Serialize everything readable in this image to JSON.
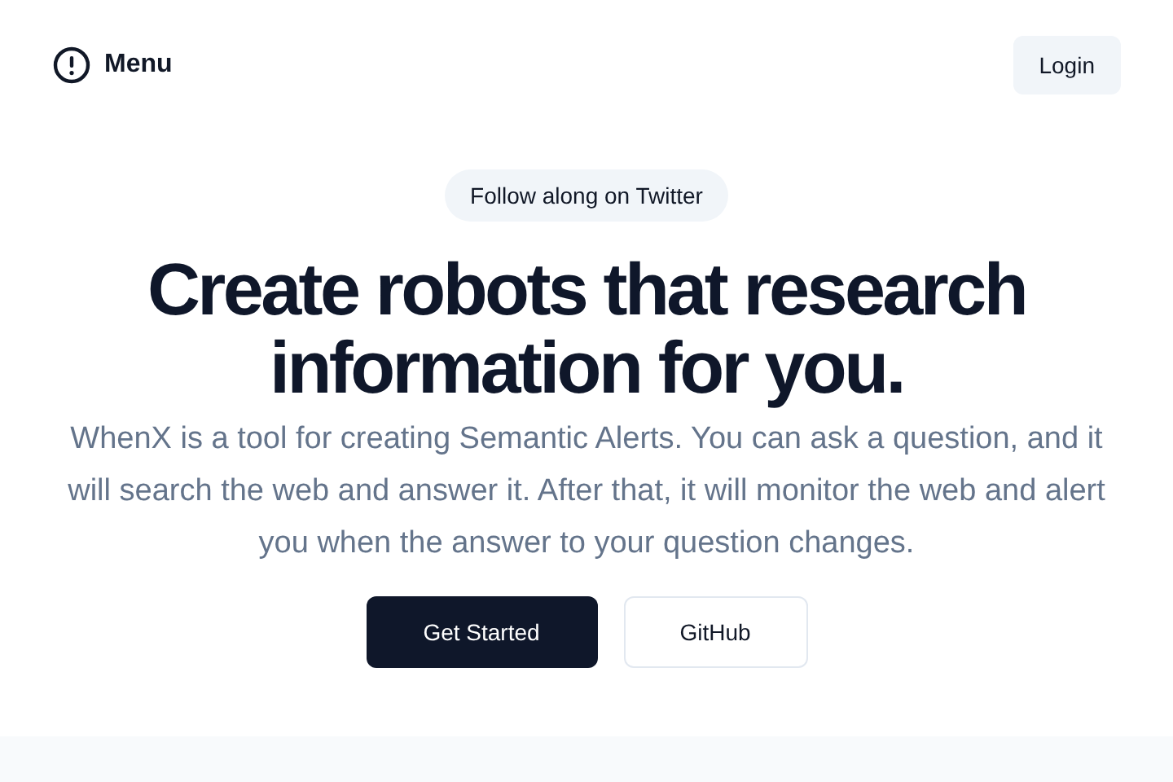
{
  "header": {
    "menu_label": "Menu",
    "login_label": "Login"
  },
  "hero": {
    "badge": "Follow along on Twitter",
    "title_lines": [
      "Create robots that research",
      "information for you."
    ],
    "description": "WhenX is a tool for creating Semantic Alerts. You can ask a question, and it will search the web and answer it. After that, it will monitor the web and alert you when the answer to your question changes.",
    "buttons": [
      {
        "label": "Get Started",
        "kind": "primary"
      },
      {
        "label": "GitHub",
        "kind": "secondary"
      }
    ]
  }
}
